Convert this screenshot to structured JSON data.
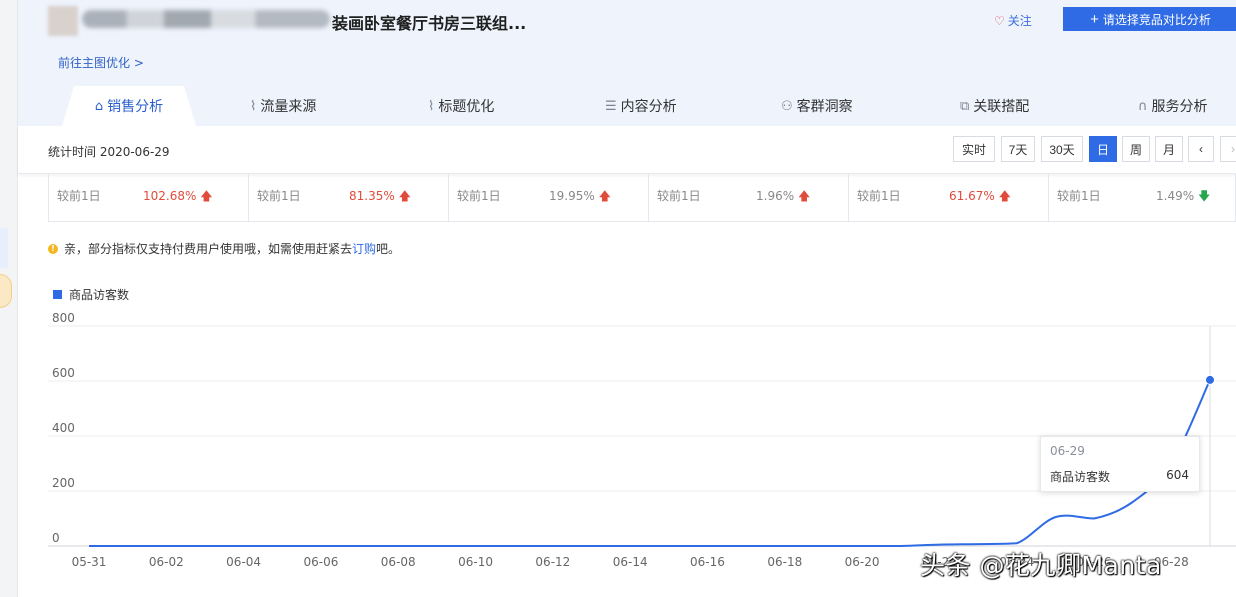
{
  "product": {
    "title": "装画卧室餐厅书房三联组...",
    "favorite_label": "关注",
    "favorite_icon": "heart-icon",
    "compare_label": "请选择竞品对比分析",
    "compare_icon": "plus-icon",
    "goto_link": "前往主图优化 >"
  },
  "tabs": [
    {
      "label": "销售分析",
      "icon": "bag-icon",
      "active": true
    },
    {
      "label": "流量来源",
      "icon": "line-chart-icon"
    },
    {
      "label": "标题优化",
      "icon": "line-chart-icon"
    },
    {
      "label": "内容分析",
      "icon": "document-icon"
    },
    {
      "label": "客群洞察",
      "icon": "users-icon"
    },
    {
      "label": "关联搭配",
      "icon": "link-icon"
    },
    {
      "label": "服务分析",
      "icon": "headset-icon"
    }
  ],
  "time_bar": {
    "stat_time": "统计时间 2020-06-29",
    "buttons": [
      "实时",
      "7天",
      "30天",
      "日",
      "周",
      "月"
    ],
    "selected": "日"
  },
  "metrics": [
    {
      "label": "较前1日",
      "value": "102.68%",
      "direction": "up"
    },
    {
      "label": "较前1日",
      "value": "81.35%",
      "direction": "up"
    },
    {
      "label": "较前1日",
      "value": "19.95%",
      "direction": "up"
    },
    {
      "label": "较前1日",
      "value": "1.96%",
      "direction": "up"
    },
    {
      "label": "较前1日",
      "value": "61.67%",
      "direction": "up"
    },
    {
      "label": "较前1日",
      "value": "1.49%",
      "direction": "down"
    }
  ],
  "notice": {
    "text": "亲，部分指标仅支持付费用户使用哦，如需使用赶紧去",
    "link": "订购",
    "suffix": "吧。"
  },
  "colors": {
    "accent": "#2f6be4",
    "up": "#e04b3b",
    "down": "#26a64f"
  },
  "chart_data": {
    "type": "line",
    "series": [
      {
        "name": "商品访客数",
        "values": [
          0,
          0,
          0,
          0,
          0,
          0,
          0,
          0,
          0,
          0,
          0,
          0,
          0,
          0,
          0,
          0,
          0,
          0,
          0,
          0,
          0,
          0,
          5,
          7,
          10,
          105,
          100,
          160,
          300,
          604
        ]
      }
    ],
    "x": [
      "05-31",
      "06-01",
      "06-02",
      "06-03",
      "06-04",
      "06-05",
      "06-06",
      "06-07",
      "06-08",
      "06-09",
      "06-10",
      "06-11",
      "06-12",
      "06-13",
      "06-14",
      "06-15",
      "06-16",
      "06-17",
      "06-18",
      "06-19",
      "06-20",
      "06-21",
      "06-22",
      "06-23",
      "06-24",
      "06-25",
      "06-26",
      "06-27",
      "06-28",
      "06-29"
    ],
    "x_tick_labels": [
      "05-31",
      "06-02",
      "06-04",
      "06-06",
      "06-08",
      "06-10",
      "06-12",
      "06-14",
      "06-16",
      "06-18",
      "06-20",
      "06-22",
      "06-24",
      "06-26",
      "06-28"
    ],
    "y_ticks": [
      0,
      200,
      400,
      600,
      800
    ],
    "ylim": [
      0,
      800
    ],
    "grid": true,
    "legend": "top-left",
    "tooltip": {
      "date": "06-29",
      "name": "商品访客数",
      "value": "604"
    }
  },
  "watermark": "头条 @花九卿Manta"
}
